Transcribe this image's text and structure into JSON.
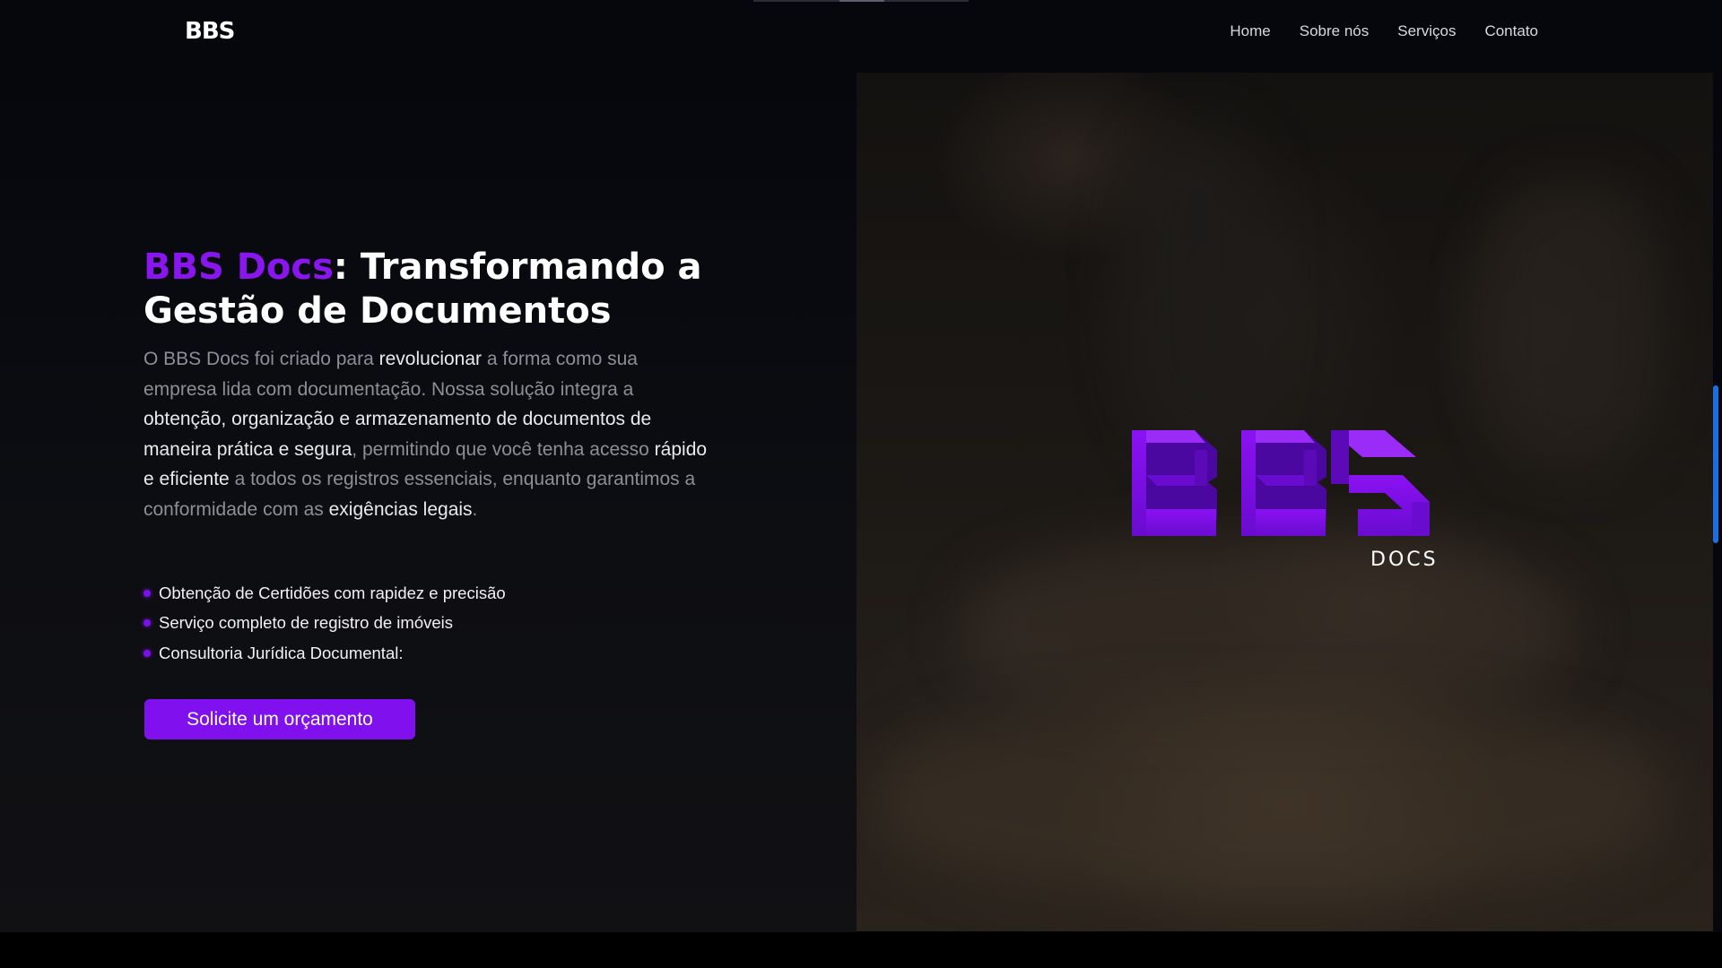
{
  "header": {
    "logo_text": "BBS",
    "nav": [
      "Home",
      "Sobre nós",
      "Serviços",
      "Contato"
    ]
  },
  "hero": {
    "title_brand": "BBS Docs",
    "title_rest": ": Transformando a Gestão de Documentos",
    "description": {
      "p1": "O BBS Docs foi criado para ",
      "h1": "revolucionar",
      "p2": " a forma como sua empresa lida com documentação. Nossa solução integra a ",
      "h2": "obtenção, organização e armazenamento de documentos de maneira prática e segura",
      "p3": ", permitindo que você tenha acesso ",
      "h3": "rápido e eficiente",
      "p4": " a todos os registros essenciais, enquanto garantimos a conformidade com as ",
      "h4": "exigências legais",
      "p5": "."
    },
    "features": [
      "Obtenção de Certidões com rapidez e precisão",
      "Serviço completo de registro de imóveis",
      "Consultoria Jurídica Documental:"
    ],
    "cta_label": "Solicite um orçamento"
  },
  "brand_logo": {
    "letters": "BBS",
    "subtitle": "DOCS"
  },
  "colors": {
    "accent": "#8010ee",
    "background": "#05070d",
    "muted_text": "#8d8f96",
    "scrollbar": "#1d6fe0"
  }
}
